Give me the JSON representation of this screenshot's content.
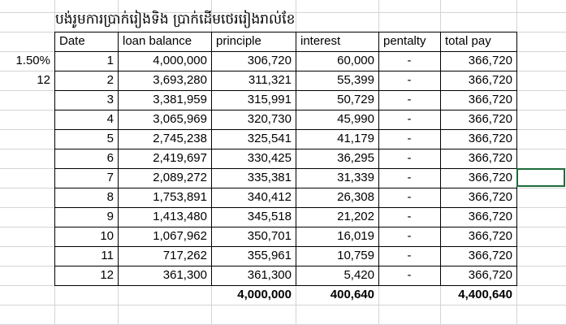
{
  "sheet": {
    "title": "បង់រូមការប្រាក់រៀងទិង ប្រាក់ដើមថេររៀងរាល់ខែ",
    "rate": "1.50%",
    "months": "12",
    "headers": [
      "Date",
      "loan balance",
      "principle",
      "interest",
      "pentalty",
      "total pay"
    ],
    "rows": [
      [
        "1",
        "4,000,000",
        "306,720",
        "60,000",
        "-",
        "366,720"
      ],
      [
        "2",
        "3,693,280",
        "311,321",
        "55,399",
        "-",
        "366,720"
      ],
      [
        "3",
        "3,381,959",
        "315,991",
        "50,729",
        "-",
        "366,720"
      ],
      [
        "4",
        "3,065,969",
        "320,730",
        "45,990",
        "-",
        "366,720"
      ],
      [
        "5",
        "2,745,238",
        "325,541",
        "41,179",
        "-",
        "366,720"
      ],
      [
        "6",
        "2,419,697",
        "330,425",
        "36,295",
        "-",
        "366,720"
      ],
      [
        "7",
        "2,089,272",
        "335,381",
        "31,339",
        "-",
        "366,720"
      ],
      [
        "8",
        "1,753,891",
        "340,412",
        "26,308",
        "-",
        "366,720"
      ],
      [
        "9",
        "1,413,480",
        "345,518",
        "21,202",
        "-",
        "366,720"
      ],
      [
        "10",
        "1,067,962",
        "350,701",
        "16,019",
        "-",
        "366,720"
      ],
      [
        "11",
        "717,262",
        "355,961",
        "10,759",
        "-",
        "366,720"
      ],
      [
        "12",
        "361,300",
        "361,300",
        "5,420",
        "-",
        "366,720"
      ]
    ],
    "totals": {
      "principle": "4,000,000",
      "interest": "400,640",
      "total_pay": "4,400,640"
    }
  }
}
